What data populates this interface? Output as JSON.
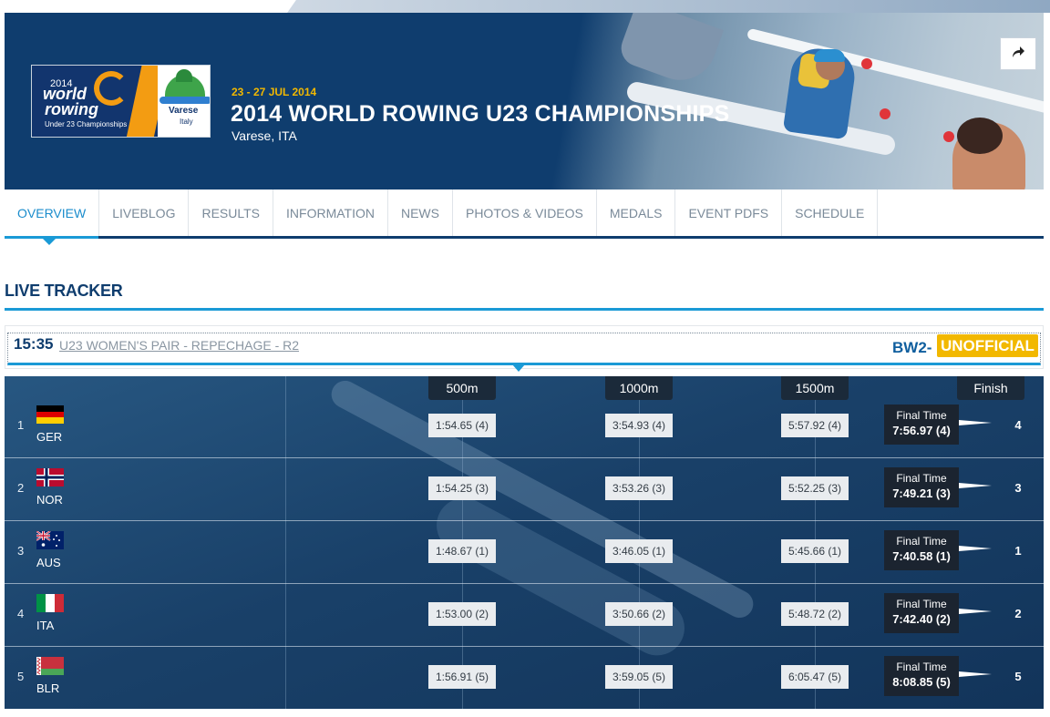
{
  "header": {
    "logo": {
      "year": "2014",
      "word1": "world",
      "word2": "rowing",
      "subtitle": "Under 23 Championships",
      "city": "Varese",
      "country": "Italy"
    },
    "dates": "23 - 27 JUL 2014",
    "title": "2014 WORLD ROWING U23 CHAMPIONSHIPS",
    "location": "Varese, ITA"
  },
  "nav": {
    "tabs": [
      {
        "label": "OVERVIEW",
        "active": true
      },
      {
        "label": "LIVEBLOG"
      },
      {
        "label": "RESULTS"
      },
      {
        "label": "INFORMATION"
      },
      {
        "label": "NEWS"
      },
      {
        "label": "PHOTOS & VIDEOS"
      },
      {
        "label": "MEDALS"
      },
      {
        "label": "EVENT PDFS"
      },
      {
        "label": "SCHEDULE"
      }
    ]
  },
  "section": {
    "title": "LIVE TRACKER"
  },
  "race": {
    "time": "15:35",
    "name": "U23 WOMEN'S PAIR - REPECHAGE - R2",
    "code": "BW2-",
    "status": "UNOFFICIAL"
  },
  "tracker": {
    "columns": [
      "500m",
      "1000m",
      "1500m",
      "Finish"
    ],
    "final_label": "Final Time",
    "rows": [
      {
        "lane": "1",
        "country": "GER",
        "flag": "de",
        "splits": [
          "1:54.65 (4)",
          "3:54.93 (4)",
          "5:57.92 (4)"
        ],
        "final": "7:56.97 (4)",
        "place": "4"
      },
      {
        "lane": "2",
        "country": "NOR",
        "flag": "no",
        "splits": [
          "1:54.25 (3)",
          "3:53.26 (3)",
          "5:52.25 (3)"
        ],
        "final": "7:49.21 (3)",
        "place": "3"
      },
      {
        "lane": "3",
        "country": "AUS",
        "flag": "au",
        "splits": [
          "1:48.67 (1)",
          "3:46.05 (1)",
          "5:45.66 (1)"
        ],
        "final": "7:40.58 (1)",
        "place": "1"
      },
      {
        "lane": "4",
        "country": "ITA",
        "flag": "it",
        "splits": [
          "1:53.00 (2)",
          "3:50.66 (2)",
          "5:48.72 (2)"
        ],
        "final": "7:42.40 (2)",
        "place": "2"
      },
      {
        "lane": "5",
        "country": "BLR",
        "flag": "by",
        "splits": [
          "1:56.91 (5)",
          "3:59.05 (5)",
          "6:05.47 (5)"
        ],
        "final": "8:08.85 (5)",
        "place": "5"
      }
    ]
  },
  "colors": {
    "navy": "#0f3d6e",
    "accent_blue": "#1a9ad6",
    "badge_yellow": "#f2b800",
    "tracker_bg": "#1f4b78"
  }
}
